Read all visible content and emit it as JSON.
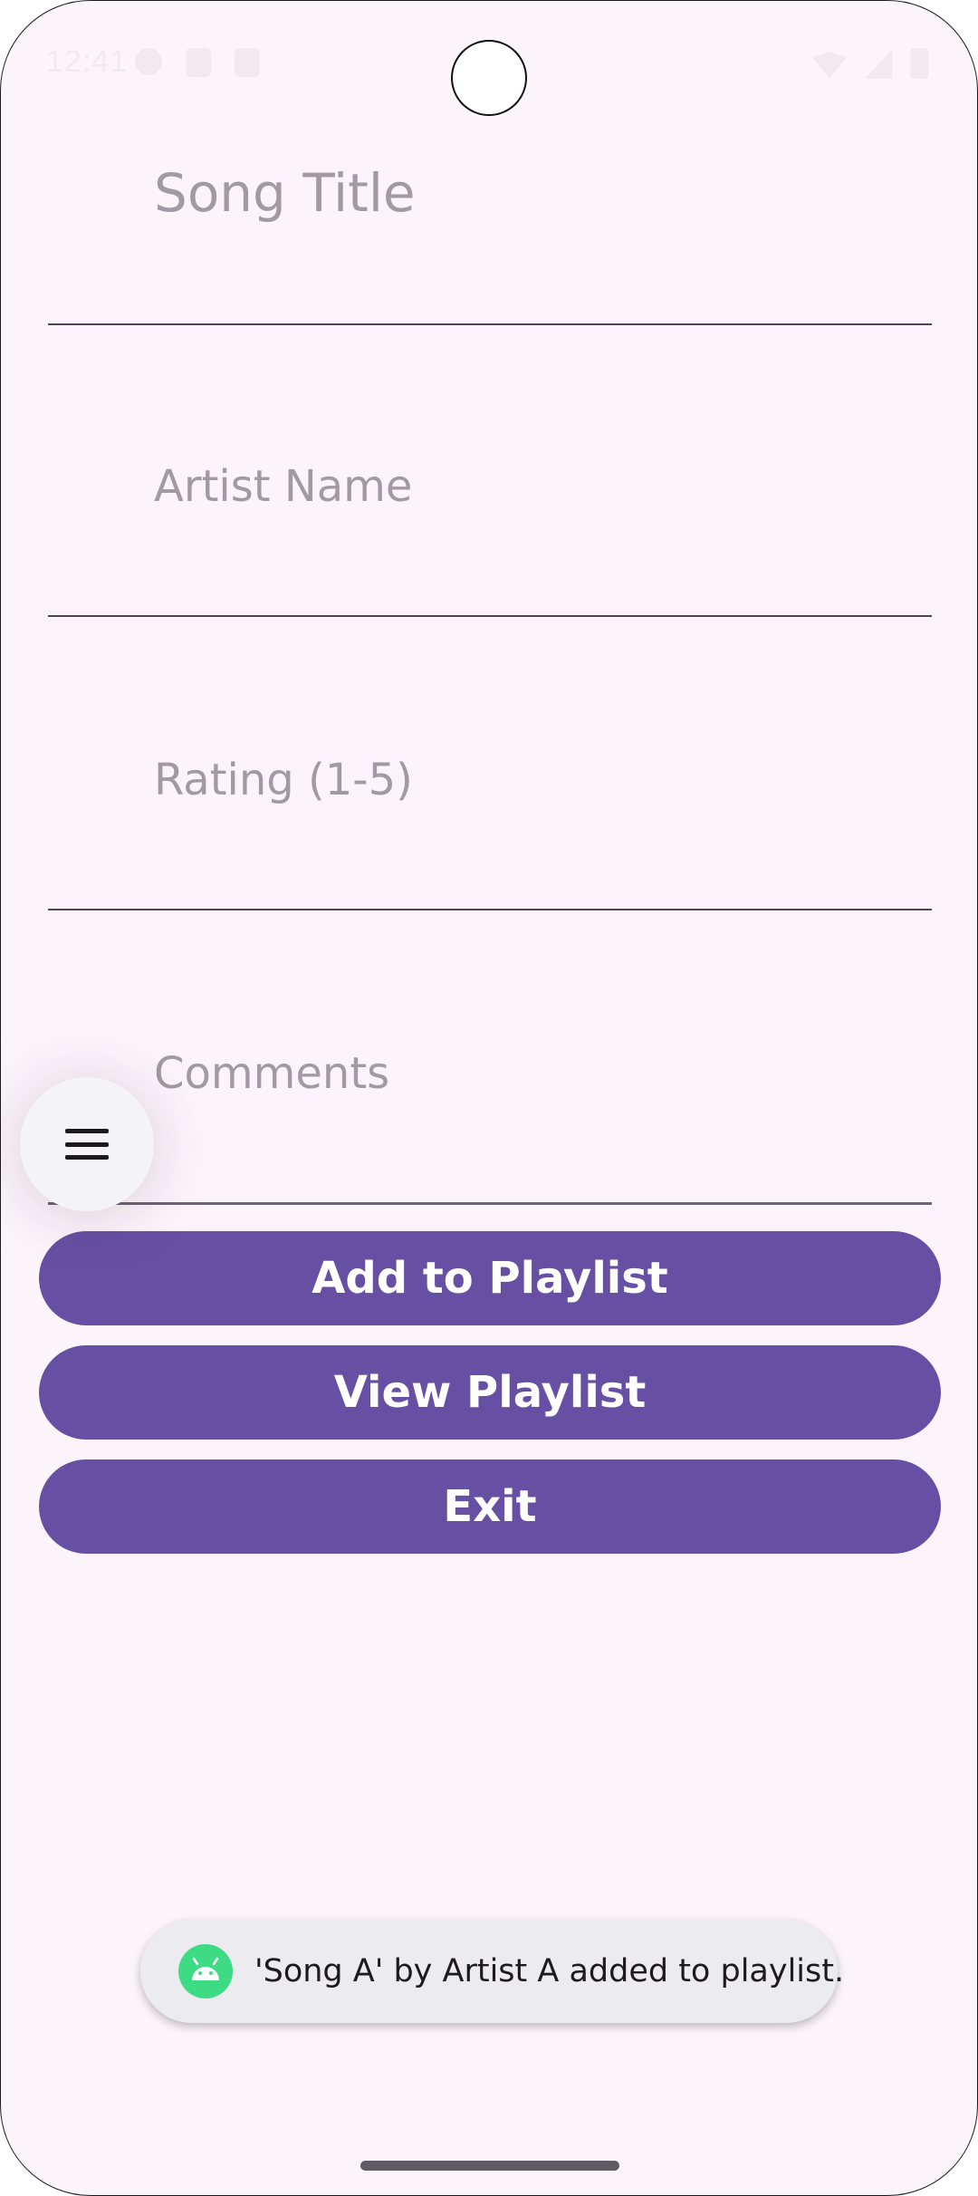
{
  "status_bar": {
    "time": "12:41"
  },
  "form": {
    "song_title_placeholder": "Song Title",
    "artist_name_placeholder": "Artist Name",
    "rating_placeholder": "Rating (1-5)",
    "comments_placeholder": "Comments"
  },
  "actions": {
    "add_label": "Add to Playlist",
    "view_label": "View Playlist",
    "exit_label": "Exit"
  },
  "toast": {
    "message": "'Song A' by Artist A added to playlist.",
    "icon": "android-icon"
  },
  "colors": {
    "background": "#fcf4fb",
    "primary": "#6750a4",
    "on_primary": "#ffffff",
    "hint_text": "#a19aa4"
  }
}
